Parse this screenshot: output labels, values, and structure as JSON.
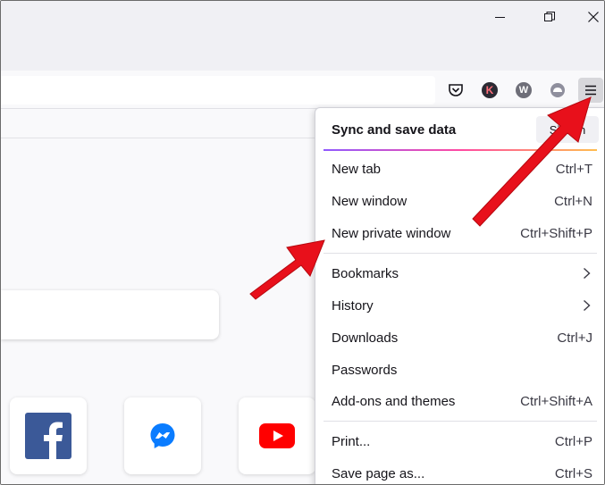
{
  "window_controls": {
    "minimize": "minimize-icon",
    "restore": "restore-icon",
    "close": "close-icon"
  },
  "toolbar_icons": {
    "pocket": "pocket-icon",
    "ext_k": "K",
    "ext_w": "W",
    "ext_cloud": "cloud-icon",
    "menu": "hamburger-menu-icon"
  },
  "menu": {
    "sync_title": "Sync and save data",
    "sign_in": "Sign In",
    "groups": [
      [
        {
          "label": "New tab",
          "shortcut": "Ctrl+T"
        },
        {
          "label": "New window",
          "shortcut": "Ctrl+N"
        },
        {
          "label": "New private window",
          "shortcut": "Ctrl+Shift+P"
        }
      ],
      [
        {
          "label": "Bookmarks",
          "submenu": true
        },
        {
          "label": "History",
          "submenu": true
        },
        {
          "label": "Downloads",
          "shortcut": "Ctrl+J"
        },
        {
          "label": "Passwords",
          "shortcut": ""
        },
        {
          "label": "Add-ons and themes",
          "shortcut": "Ctrl+Shift+A"
        }
      ],
      [
        {
          "label": "Print...",
          "shortcut": "Ctrl+P"
        },
        {
          "label": "Save page as...",
          "shortcut": "Ctrl+S"
        }
      ]
    ]
  },
  "shortcuts_tiles": [
    "Facebook",
    "Messenger",
    "YouTube"
  ],
  "colors": {
    "accent_arrow": "#e8101b",
    "facebook": "#3b5998",
    "messenger": "#0a7cff",
    "youtube": "#ff0000"
  }
}
